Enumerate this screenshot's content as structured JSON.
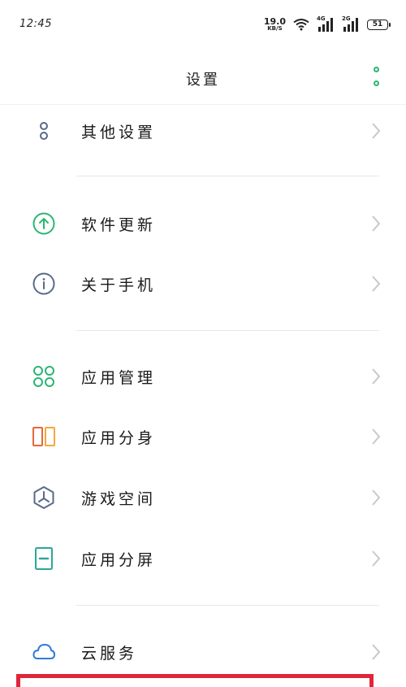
{
  "status": {
    "time": "12:45",
    "net_speed": "19.0",
    "net_unit": "KB/S",
    "sim1_tag": "4G",
    "sim2_tag": "2G",
    "battery": "51"
  },
  "header": {
    "title": "设置"
  },
  "settings": [
    {
      "label": "其他设置",
      "icon": "dots-icon"
    },
    {
      "label": "软件更新",
      "icon": "arrow-up-circle-icon"
    },
    {
      "label": "关于手机",
      "icon": "info-circle-icon"
    },
    {
      "label": "应用管理",
      "icon": "app-grid-icon"
    },
    {
      "label": "应用分身",
      "icon": "app-clone-icon"
    },
    {
      "label": "游戏空间",
      "icon": "game-space-icon"
    },
    {
      "label": "应用分屏",
      "icon": "split-screen-icon"
    },
    {
      "label": "云服务",
      "icon": "cloud-icon"
    }
  ],
  "colors": {
    "accent_green": "#2bb673",
    "highlight_red": "#e0263a"
  }
}
